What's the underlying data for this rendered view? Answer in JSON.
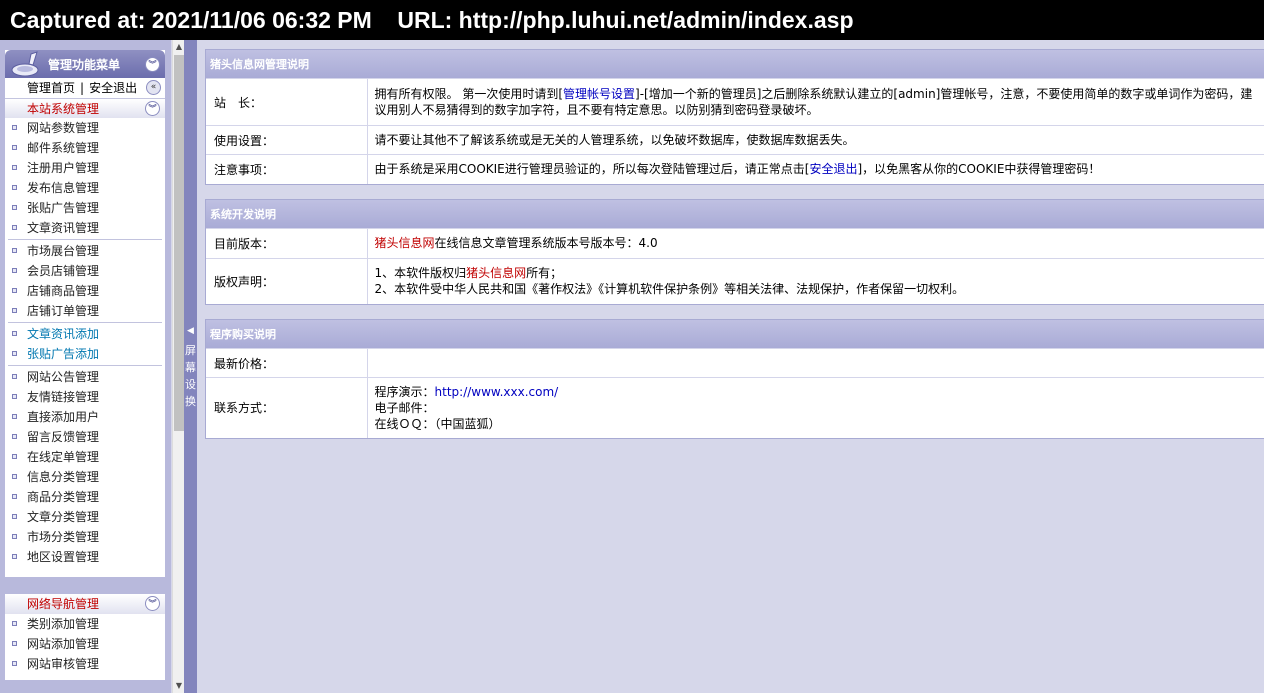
{
  "caption": "Captured at: 2021/11/06 06:32 PM    URL: http://php.luhui.net/admin/index.asp",
  "menu": {
    "title": "管理功能菜单",
    "home_link": "管理首页",
    "separator": "|",
    "logout_link": "安全退出",
    "section1": {
      "title": "本站系统管理",
      "groups": [
        [
          "网站参数管理",
          "邮件系统管理",
          "注册用户管理",
          "发布信息管理",
          "张贴广告管理",
          "文章资讯管理"
        ],
        [
          "市场展台管理",
          "会员店铺管理",
          "店铺商品管理",
          "店铺订单管理"
        ],
        [
          "文章资讯添加",
          "张贴广告添加"
        ],
        [
          "网站公告管理",
          "友情链接管理",
          "直接添加用户",
          "留言反馈管理",
          "在线定单管理",
          "信息分类管理",
          "商品分类管理",
          "文章分类管理",
          "市场分类管理",
          "地区设置管理"
        ]
      ]
    },
    "section2": {
      "title": "网络导航管理",
      "items": [
        "类别添加管理",
        "网站添加管理",
        "网站审核管理"
      ]
    }
  },
  "toggle_label": [
    "屏",
    "幕",
    "设",
    "换"
  ],
  "panel1": {
    "title": "猪头信息网管理说明",
    "row1_label": "站　长：",
    "row1_a": "拥有所有权限。 第一次使用时请到[",
    "row1_link1": "管理帐号设置",
    "row1_b": "]-[增加一个新的管理员]之后删除系统默认建立的[admin]管理帐号，注意，不要使用简单的数字或单词作为密码，建议用别人不易猜得到的数字加字符，且不要有特定意思。以防别猜到密码登录破坏。",
    "row2_label": "使用设置：",
    "row2_value": "请不要让其他不了解该系统或是无关的人管理系统，以免破坏数据库，使数据库数据丢失。",
    "row3_label": "注意事项：",
    "row3_a": "由于系统是采用COOKIE进行管理员验证的，所以每次登陆管理过后，请正常点击[",
    "row3_link": "安全退出",
    "row3_b": "]，以免黑客从你的COOKIE中获得管理密码！"
  },
  "panel2": {
    "title": "系统开发说明",
    "row1_label": "目前版本：",
    "row1_link": "猪头信息网",
    "row1_value": "在线信息文章管理系统版本号版本号：4.0",
    "row2_label": "版权声明：",
    "row2_line1_a": "1、本软件版权归",
    "row2_line1_link": "猪头信息网",
    "row2_line1_b": "所有；",
    "row2_line2": "2、本软件受中华人民共和国《著作权法》《计算机软件保护条例》等相关法律、法规保护，作者保留一切权利。"
  },
  "panel3": {
    "title": "程序购买说明",
    "row1_label": "最新价格：",
    "row2_label": "联系方式：",
    "demo_label": "程序演示：",
    "demo_url": "http://www.xxx.com/",
    "email_label": "电子邮件：",
    "qq_label": "在线ＯＱ：（中国蓝狐）"
  },
  "colors": {
    "header_bar": "#a9abd6",
    "sidebar": "#b8b9dc",
    "background": "#d6d7ea",
    "section_red": "#c00000",
    "link_blue": "#0000c0"
  }
}
